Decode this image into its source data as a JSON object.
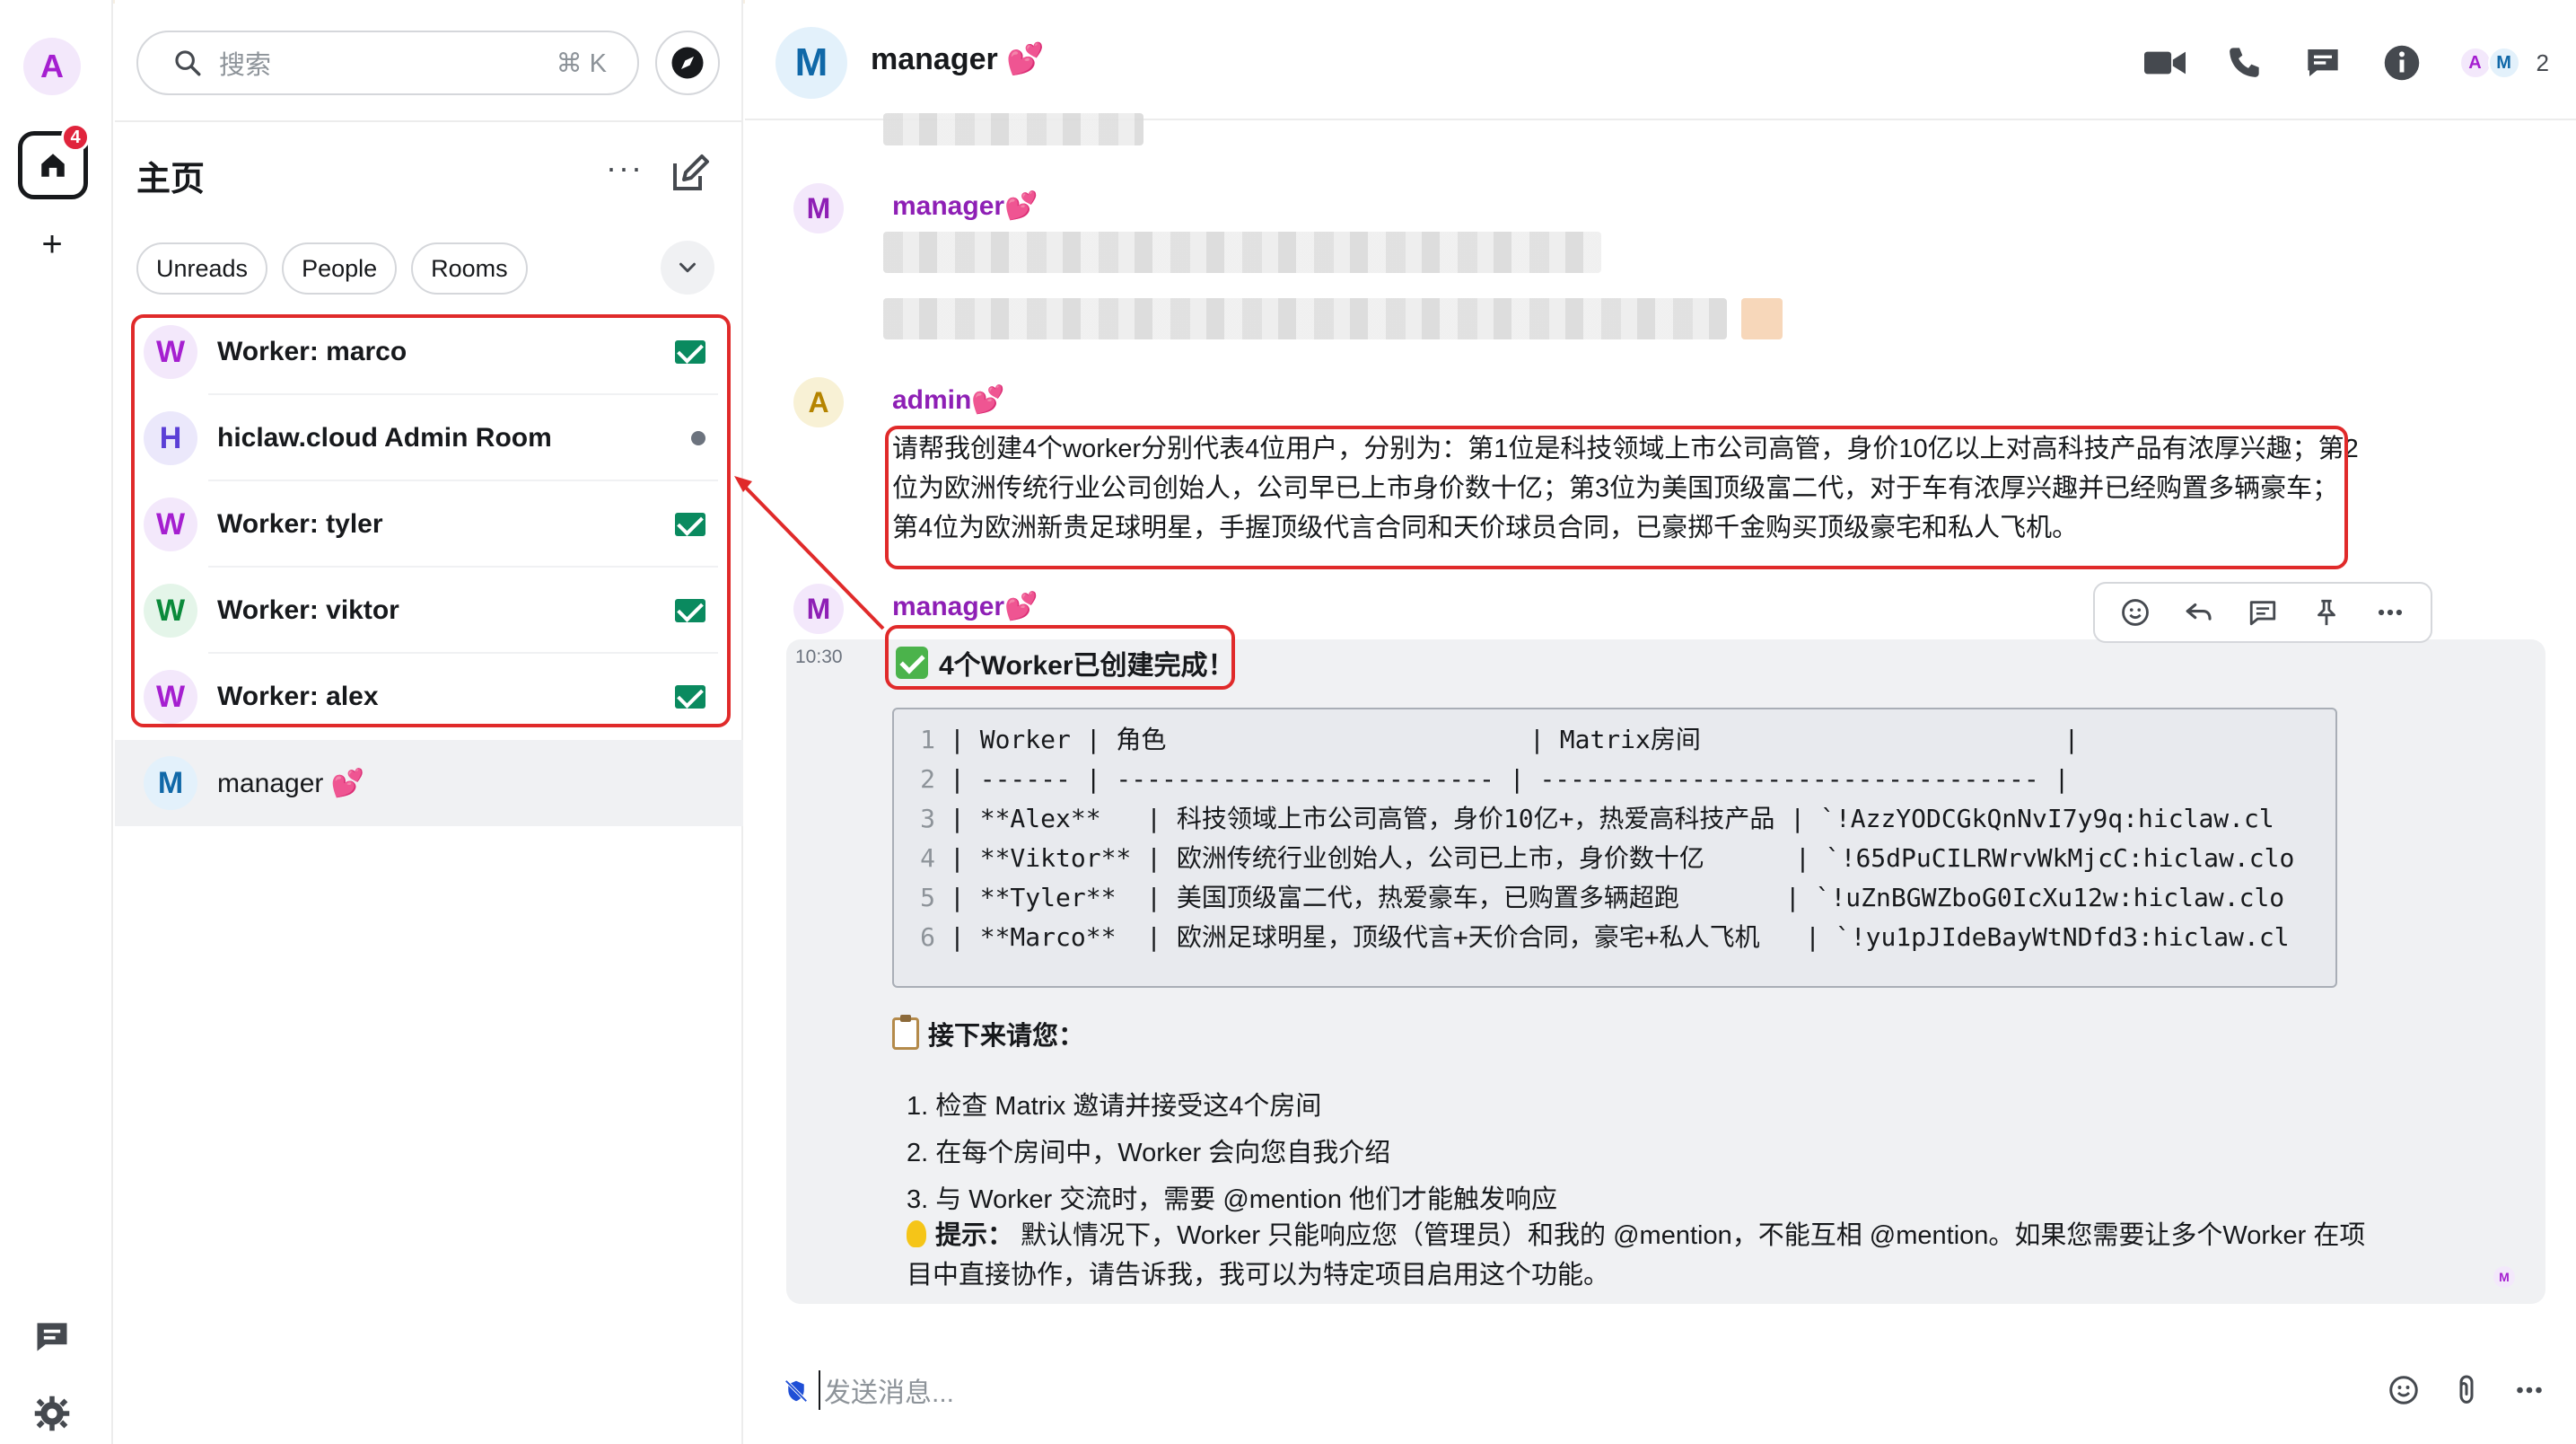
{
  "rail": {
    "user_initial": "A",
    "home_badge": "4",
    "add_symbol": "+"
  },
  "roomlist": {
    "search_placeholder": "搜索",
    "search_shortcut": "⌘ K",
    "title": "主页",
    "more_symbol": "···",
    "filters": [
      "Unreads",
      "People",
      "Rooms"
    ],
    "rooms": [
      {
        "initial": "W",
        "name": "Worker: marco",
        "indicator": "invite-icon"
      },
      {
        "initial": "H",
        "name": "hiclaw.cloud Admin Room",
        "indicator": "unread-dot"
      },
      {
        "initial": "W",
        "name": "Worker: tyler",
        "indicator": "invite-icon"
      },
      {
        "initial": "W",
        "name": "Worker: viktor",
        "indicator": "invite-icon"
      },
      {
        "initial": "W",
        "name": "Worker: alex",
        "indicator": "invite-icon"
      },
      {
        "initial": "M",
        "name": "manager",
        "heart": "💕"
      }
    ]
  },
  "header": {
    "room_initial": "M",
    "room_name": "manager",
    "heart": "💕",
    "member_initials": [
      "A",
      "M"
    ],
    "member_count": "2"
  },
  "timeline": {
    "messages": [
      {
        "sender_initial": "M",
        "sender": "manager",
        "heart": "💕"
      },
      {
        "sender_initial": "A",
        "sender": "admin",
        "heart": "💕",
        "body": "请帮我创建4个worker分别代表4位用户，分别为：第1位是科技领域上市公司高管，身价10亿以上对高科技产品有浓厚兴趣；第2位为欧洲传统行业公司创始人，公司早已上市身价数十亿；第3位为美国顶级富二代，对于车有浓厚兴趣并已经购置多辆豪车；第4位为欧洲新贵足球明星，手握顶级代言合同和天价球员合同，已豪掷千金购买顶级豪宅和私人飞机。"
      },
      {
        "sender_initial": "M",
        "sender": "manager",
        "heart": "💕",
        "time": "10:30",
        "headline": "4个Worker已创建完成！",
        "code_lines": [
          "| Worker | 角色                        | Matrix房间                        |",
          "| ------ | ------------------------- | --------------------------------- |",
          "| **Alex**   | 科技领域上市公司高管，身价10亿+，热爱高科技产品 | `!AzzYODCGkQnNvI7y9q:hiclaw.cl",
          "| **Viktor** | 欧洲传统行业创始人，公司已上市，身价数十亿      | `!65dPuCILRWrvWkMjcC:hiclaw.clo",
          "| **Tyler**  | 美国顶级富二代，热爱豪车，已购置多辆超跑       | `!uZnBGWZboG0IcXu12w:hiclaw.clo",
          "| **Marco**  | 欧洲足球明星，顶级代言+天价合同，豪宅+私人飞机   | `!yu1pJIdeBayWtNDfd3:hiclaw.cl"
        ],
        "next_title": "接下来请您：",
        "steps": [
          "1. 检查 Matrix 邀请并接受这4个房间",
          "2. 在每个房间中，Worker 会向您自我介绍",
          "3. 与 Worker 交流时，需要 @mention 他们才能触发响应"
        ],
        "tip_label": "提示：",
        "tip_body": "默认情况下，Worker 只能响应您（管理员）和我的 @mention，不能互相 @mention。如果您需要让多个Worker 在项目中直接协作，请告诉我，我可以为特定项目启用这个功能。",
        "read_receipt": "M"
      }
    ]
  },
  "composer": {
    "placeholder": "发送消息..."
  },
  "colors": {
    "accent_purple": "#a51fd0",
    "green": "#0a8a5f",
    "annotation_red": "#e02a2a"
  }
}
